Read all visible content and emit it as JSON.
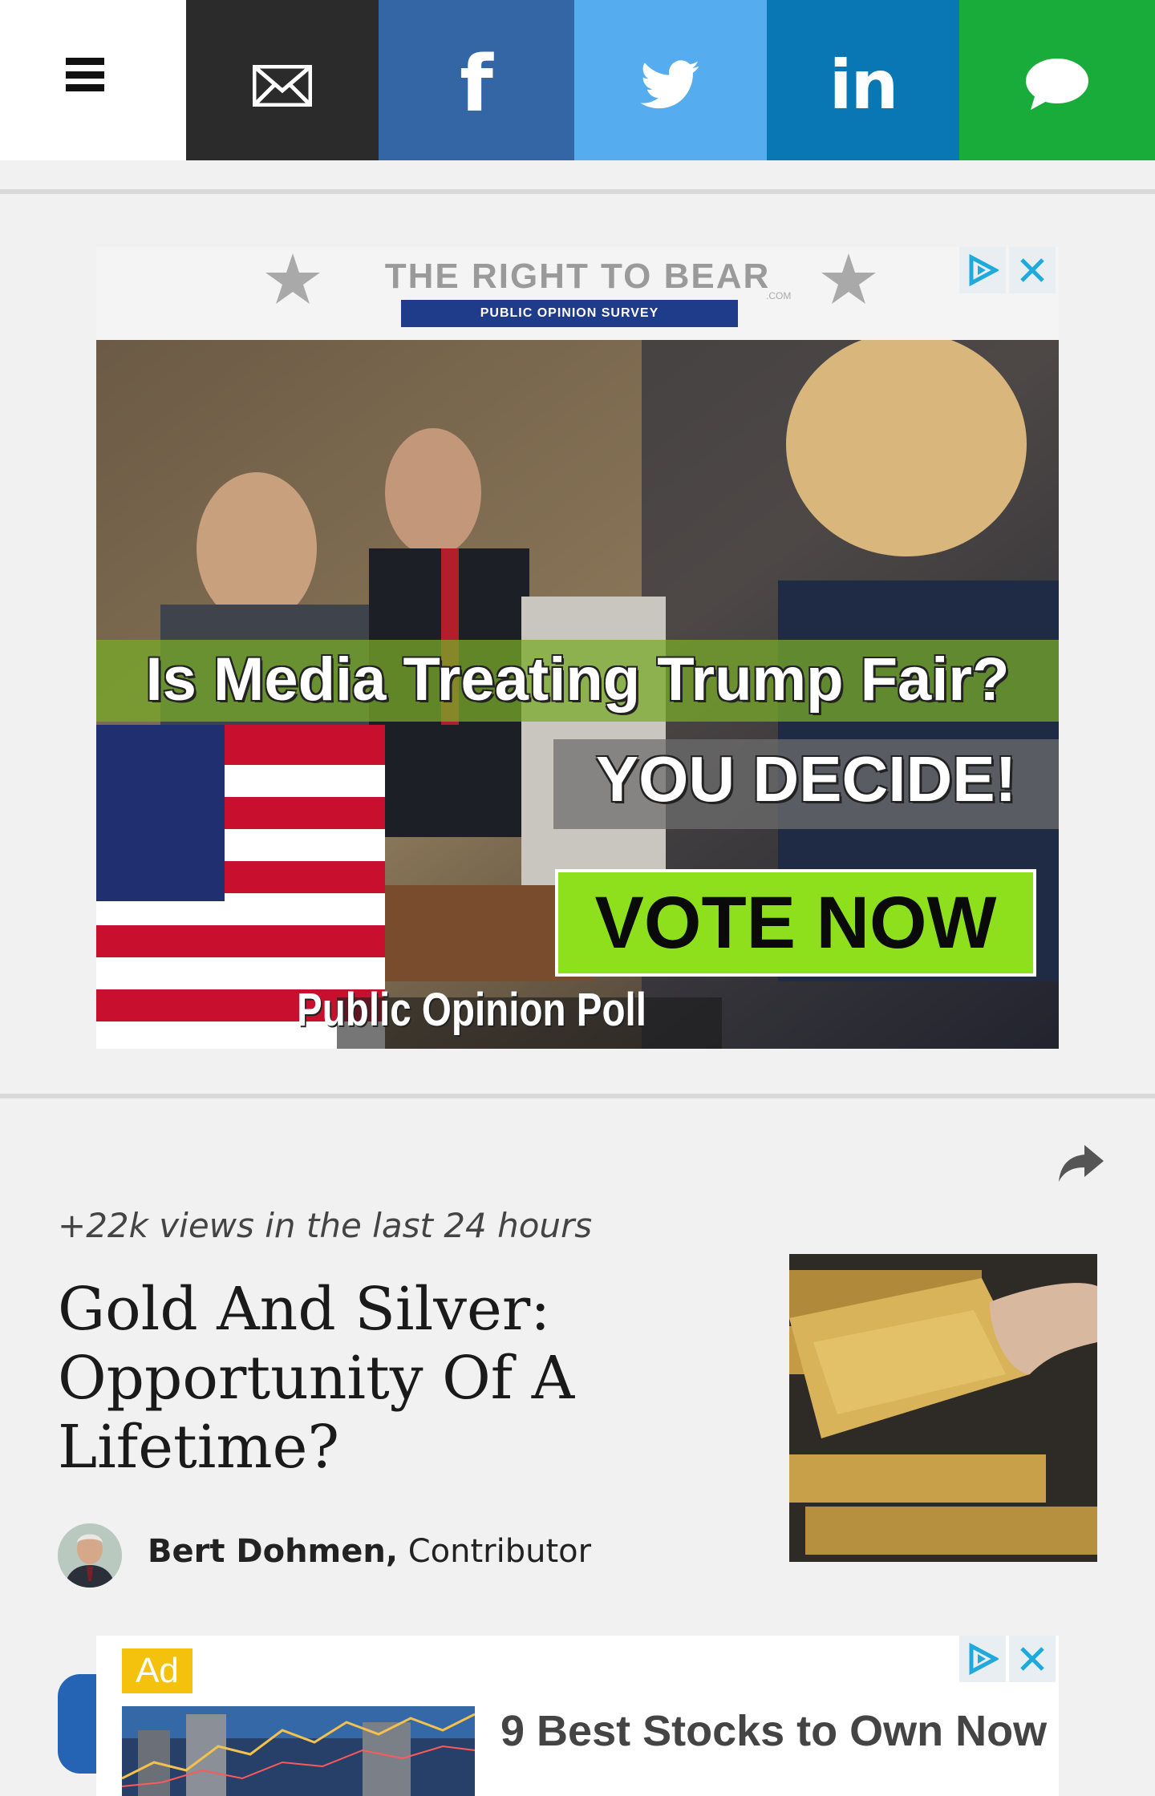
{
  "top_bar": {
    "buttons": [
      {
        "name": "menu",
        "icon": "hamburger-icon",
        "color": "#ffffff"
      },
      {
        "name": "email",
        "icon": "envelope-icon",
        "color": "#2b2b2b"
      },
      {
        "name": "facebook",
        "icon": "facebook-icon",
        "label": "f",
        "color": "#3465a4"
      },
      {
        "name": "twitter",
        "icon": "twitter-bird-icon",
        "color": "#55acee"
      },
      {
        "name": "linkedin",
        "icon": "linkedin-icon",
        "label": "in",
        "color": "#0a77b5"
      },
      {
        "name": "sms",
        "icon": "chat-bubble-icon",
        "color": "#1aac3b"
      }
    ]
  },
  "ad_top": {
    "brand": "THE RIGHT TO BEAR",
    "brand_suffix": ".COM",
    "ribbon": "PUBLIC OPINION SURVEY",
    "headline": "Is Media Treating Trump Fair?",
    "subheadline": "YOU DECIDE!",
    "cta": "VOTE NOW",
    "footer": "Public Opinion Poll",
    "controls": [
      "adchoices-icon",
      "close-icon"
    ]
  },
  "article": {
    "views": "+22k views in the last 24 hours",
    "title": "Gold And Silver: Opportunity Of A Lifetime?",
    "author_name": "Bert Dohmen,",
    "author_role": " Contributor",
    "share_icon": "share-arrow-icon"
  },
  "ad_bottom": {
    "badge": "Ad",
    "text": "9 Best Stocks to Own Now",
    "controls": [
      "adchoices-icon",
      "close-icon"
    ]
  }
}
